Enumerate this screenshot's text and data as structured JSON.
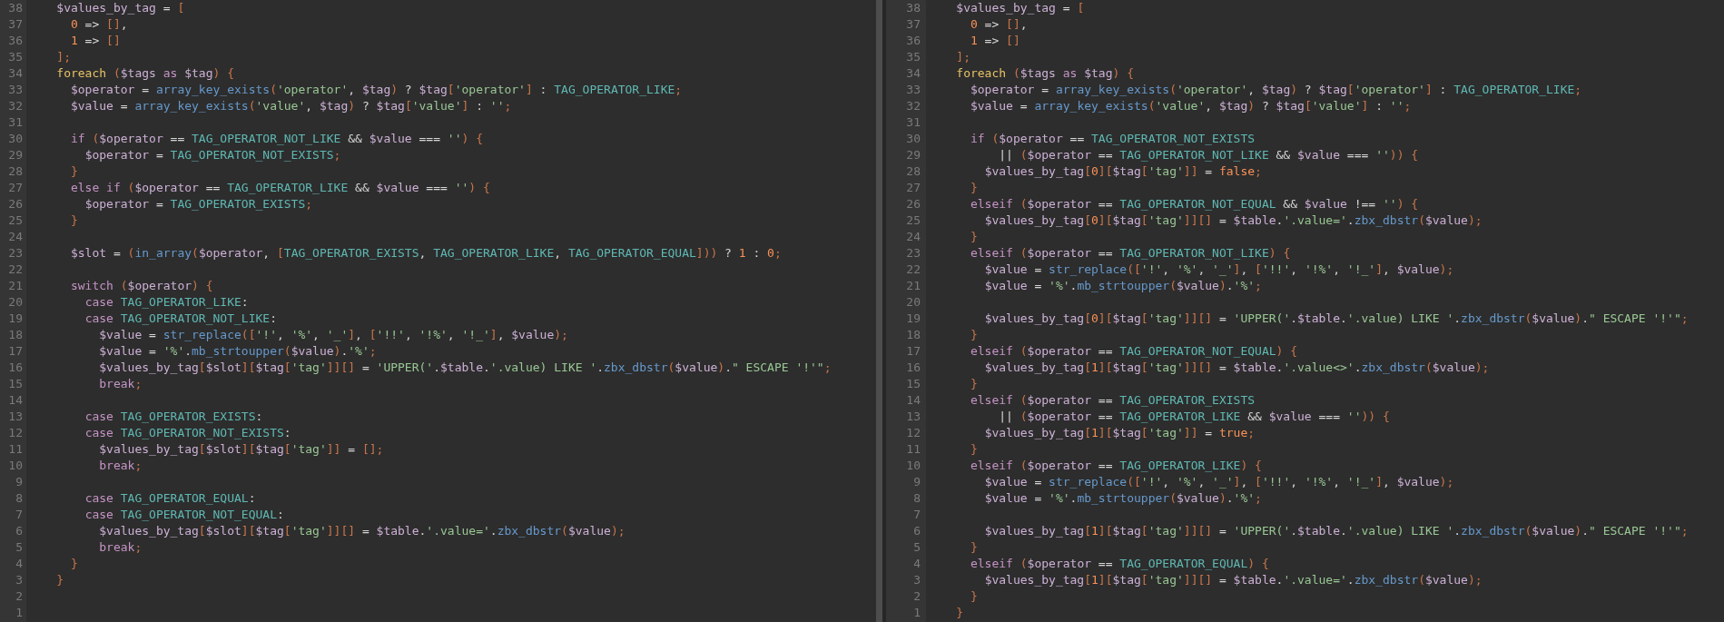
{
  "panes": [
    {
      "lines": [
        {
          "number": "38",
          "text": "    $values_by_tag = ["
        },
        {
          "number": "37",
          "text": "      0 => [],"
        },
        {
          "number": "36",
          "text": "      1 => []"
        },
        {
          "number": "35",
          "text": "    ];"
        },
        {
          "number": "34",
          "text": "    foreach ($tags as $tag) {"
        },
        {
          "number": "33",
          "text": "      $operator = array_key_exists('operator', $tag) ? $tag['operator'] : TAG_OPERATOR_LIKE;"
        },
        {
          "number": "32",
          "text": "      $value = array_key_exists('value', $tag) ? $tag['value'] : '';"
        },
        {
          "number": "31"
        },
        {
          "number": "30",
          "text": "      if ($operator == TAG_OPERATOR_NOT_LIKE && $value === '') {"
        },
        {
          "number": "29",
          "text": "        $operator = TAG_OPERATOR_NOT_EXISTS;"
        },
        {
          "number": "28",
          "text": "      }"
        },
        {
          "number": "27",
          "text": "      else if ($operator == TAG_OPERATOR_LIKE && $value === '') {"
        },
        {
          "number": "26",
          "text": "        $operator = TAG_OPERATOR_EXISTS;"
        },
        {
          "number": "25",
          "text": "      }"
        },
        {
          "number": "24"
        },
        {
          "number": "23",
          "text": "      $slot = (in_array($operator, [TAG_OPERATOR_EXISTS, TAG_OPERATOR_LIKE, TAG_OPERATOR_EQUAL])) ? 1 : 0;"
        },
        {
          "number": "22"
        },
        {
          "number": "21",
          "text": "      switch ($operator) {"
        },
        {
          "number": "20",
          "text": "        case TAG_OPERATOR_LIKE:"
        },
        {
          "number": "19",
          "text": "        case TAG_OPERATOR_NOT_LIKE:"
        },
        {
          "number": "18",
          "text": "          $value = str_replace(['!', '%', '_'], ['!!', '!%', '!_'], $value);"
        },
        {
          "number": "17",
          "text": "          $value = '%'.mb_strtoupper($value).'%';"
        },
        {
          "number": "16",
          "text": "          $values_by_tag[$slot][$tag['tag']][] = 'UPPER('.$table.'.value) LIKE '.zbx_dbstr($value).\" ESCAPE '!'\";"
        },
        {
          "number": "15",
          "text": "          break;"
        },
        {
          "number": "14"
        },
        {
          "number": "13",
          "text": "        case TAG_OPERATOR_EXISTS:"
        },
        {
          "number": "12",
          "text": "        case TAG_OPERATOR_NOT_EXISTS:"
        },
        {
          "number": "11",
          "text": "          $values_by_tag[$slot][$tag['tag']] = [];"
        },
        {
          "number": "10",
          "text": "          break;"
        },
        {
          "number": "9"
        },
        {
          "number": "8",
          "text": "        case TAG_OPERATOR_EQUAL:"
        },
        {
          "number": "7",
          "text": "        case TAG_OPERATOR_NOT_EQUAL:"
        },
        {
          "number": "6",
          "text": "          $values_by_tag[$slot][$tag['tag']][] = $table.'.value='.zbx_dbstr($value);"
        },
        {
          "number": "5",
          "text": "          break;"
        },
        {
          "number": "4",
          "text": "      }"
        },
        {
          "number": "3",
          "text": "    }"
        },
        {
          "number": "2"
        },
        {
          "number": "1"
        }
      ]
    },
    {
      "lines": [
        {
          "number": "38",
          "text": "    $values_by_tag = ["
        },
        {
          "number": "37",
          "text": "      0 => [],"
        },
        {
          "number": "36",
          "text": "      1 => []"
        },
        {
          "number": "35",
          "text": "    ];"
        },
        {
          "number": "34",
          "text": "    foreach ($tags as $tag) {"
        },
        {
          "number": "33",
          "text": "      $operator = array_key_exists('operator', $tag) ? $tag['operator'] : TAG_OPERATOR_LIKE;"
        },
        {
          "number": "32",
          "text": "      $value = array_key_exists('value', $tag) ? $tag['value'] : '';"
        },
        {
          "number": "31"
        },
        {
          "number": "30",
          "text": "      if ($operator == TAG_OPERATOR_NOT_EXISTS"
        },
        {
          "number": "29",
          "text": "          || ($operator == TAG_OPERATOR_NOT_LIKE && $value === '')) {"
        },
        {
          "number": "28",
          "text": "        $values_by_tag[0][$tag['tag']] = false;"
        },
        {
          "number": "27",
          "text": "      }"
        },
        {
          "number": "26",
          "text": "      elseif ($operator == TAG_OPERATOR_NOT_EQUAL && $value !== '') {"
        },
        {
          "number": "25",
          "text": "        $values_by_tag[0][$tag['tag']][] = $table.'.value='.zbx_dbstr($value);"
        },
        {
          "number": "24",
          "text": "      }"
        },
        {
          "number": "23",
          "text": "      elseif ($operator == TAG_OPERATOR_NOT_LIKE) {"
        },
        {
          "number": "22",
          "text": "        $value = str_replace(['!', '%', '_'], ['!!', '!%', '!_'], $value);"
        },
        {
          "number": "21",
          "text": "        $value = '%'.mb_strtoupper($value).'%';"
        },
        {
          "number": "20"
        },
        {
          "number": "19",
          "text": "        $values_by_tag[0][$tag['tag']][] = 'UPPER('.$table.'.value) LIKE '.zbx_dbstr($value).\" ESCAPE '!'\";"
        },
        {
          "number": "18",
          "text": "      }"
        },
        {
          "number": "17",
          "text": "      elseif ($operator == TAG_OPERATOR_NOT_EQUAL) {"
        },
        {
          "number": "16",
          "text": "        $values_by_tag[1][$tag['tag']][] = $table.'.value<>'.zbx_dbstr($value);"
        },
        {
          "number": "15",
          "text": "      }"
        },
        {
          "number": "14",
          "text": "      elseif ($operator == TAG_OPERATOR_EXISTS"
        },
        {
          "number": "13",
          "text": "          || ($operator == TAG_OPERATOR_LIKE && $value === '')) {"
        },
        {
          "number": "12",
          "text": "        $values_by_tag[1][$tag['tag']] = true;"
        },
        {
          "number": "11",
          "text": "      }"
        },
        {
          "number": "10",
          "text": "      elseif ($operator == TAG_OPERATOR_LIKE) {"
        },
        {
          "number": "9",
          "text": "        $value = str_replace(['!', '%', '_'], ['!!', '!%', '!_'], $value);"
        },
        {
          "number": "8",
          "text": "        $value = '%'.mb_strtoupper($value).'%';"
        },
        {
          "number": "7"
        },
        {
          "number": "6",
          "text": "        $values_by_tag[1][$tag['tag']][] = 'UPPER('.$table.'.value) LIKE '.zbx_dbstr($value).\" ESCAPE '!'\";"
        },
        {
          "number": "5",
          "text": "      }"
        },
        {
          "number": "4",
          "text": "      elseif ($operator == TAG_OPERATOR_EQUAL) {"
        },
        {
          "number": "3",
          "text": "        $values_by_tag[1][$tag['tag']][] = $table.'.value='.zbx_dbstr($value);"
        },
        {
          "number": "2",
          "text": "      }"
        },
        {
          "number": "1",
          "text": "    }"
        }
      ]
    }
  ]
}
